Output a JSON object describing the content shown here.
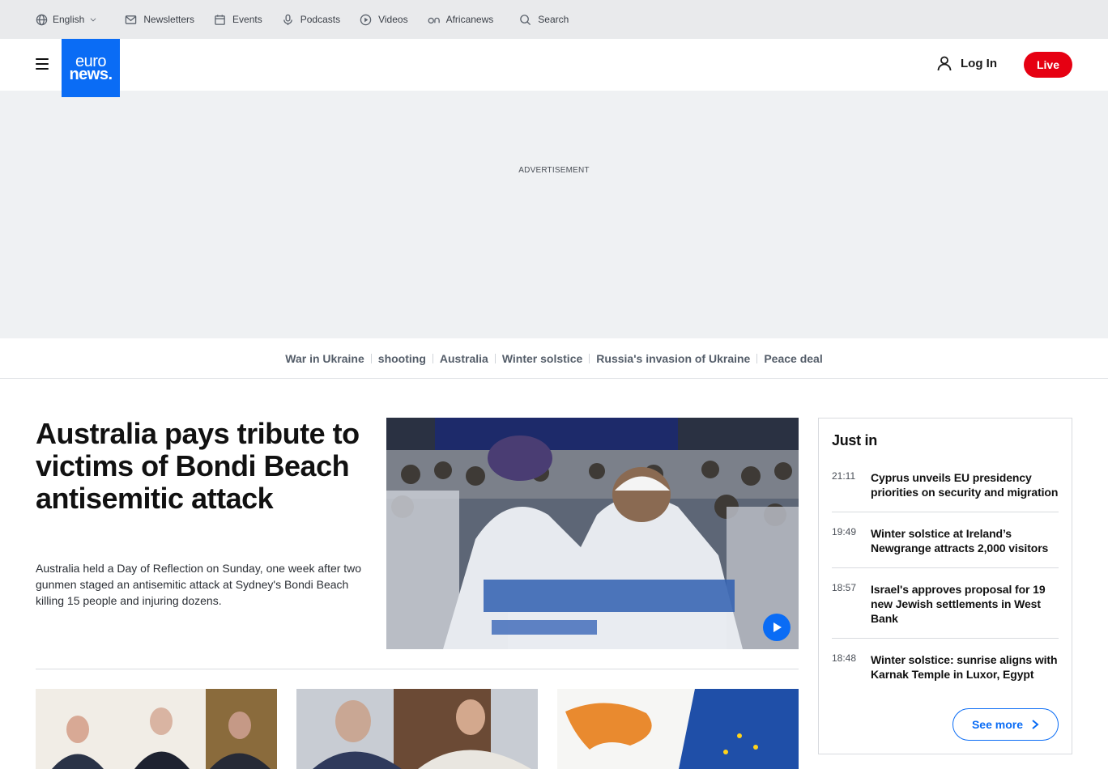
{
  "topbar": {
    "language": "English",
    "newsletters": "Newsletters",
    "events": "Events",
    "podcasts": "Podcasts",
    "videos": "Videos",
    "africanews": "Africanews",
    "search": "Search"
  },
  "header": {
    "logo_line1": "euro",
    "logo_line2": "news.",
    "login": "Log In",
    "live": "Live",
    "brand_color": "#0a6cf5",
    "live_color": "#e60012"
  },
  "ad": {
    "label": "ADVERTISEMENT"
  },
  "topics": [
    "War in Ukraine",
    "shooting",
    "Australia",
    "Winter solstice",
    "Russia's invasion of Ukraine",
    "Peace deal"
  ],
  "lead": {
    "title": "Australia pays tribute to victims of Bondi Beach antisemitic attack",
    "summary": "Australia held a Day of Reflection on Sunday, one week after two gunmen staged an antisemitic attack at Sydney's Bondi Beach killing 15 people and injuring dozens."
  },
  "just_in": {
    "title": "Just in",
    "items": [
      {
        "time": "21:11",
        "headline": "Cyprus unveils EU presidency priorities on security and migration"
      },
      {
        "time": "19:49",
        "headline": "Winter solstice at Ireland’s Newgrange attracts 2,000 visitors"
      },
      {
        "time": "18:57",
        "headline": "Israel's approves proposal for 19 new Jewish settlements in West Bank"
      },
      {
        "time": "18:48",
        "headline": "Winter solstice: sunrise aligns with Karnak Temple in Luxor, Egypt"
      }
    ],
    "see_more": "See more"
  }
}
